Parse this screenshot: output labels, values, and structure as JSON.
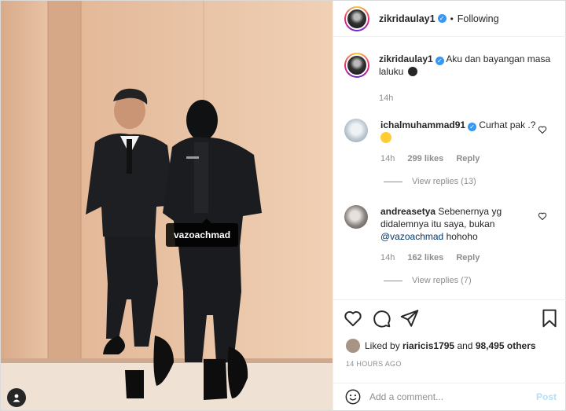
{
  "post": {
    "tagged_user": "vazoachmad"
  },
  "header": {
    "username": "zikridaulay1",
    "separator": "•",
    "follow_status": "Following"
  },
  "caption": {
    "username": "zikridaulay1",
    "text": "Aku dan bayangan masa laluku",
    "time": "14h"
  },
  "comments": [
    {
      "username": "ichalmuhammad91",
      "verified": true,
      "text": "Curhat pak .?",
      "time": "14h",
      "likes": "299 likes",
      "reply_label": "Reply",
      "view_replies": "View replies (13)"
    },
    {
      "username": "andreasetya",
      "verified": false,
      "text_before": "Sebenernya yg didalemnya itu saya, bukan",
      "mention": "@vazoachmad",
      "text_after": "hohoho",
      "time": "14h",
      "likes": "162 likes",
      "reply_label": "Reply",
      "view_replies": "View replies (7)"
    }
  ],
  "likes": {
    "prefix": "Liked by",
    "user": "riaricis1795",
    "joiner": "and",
    "others": "98,495 others"
  },
  "timestamp": "14 HOURS AGO",
  "add_comment": {
    "placeholder": "Add a comment...",
    "post_label": "Post"
  },
  "colors": {
    "verified": "#3897f0",
    "mention": "#00376b",
    "post_disabled": "#b2dffc",
    "meta_gray": "#8e8e8e"
  }
}
